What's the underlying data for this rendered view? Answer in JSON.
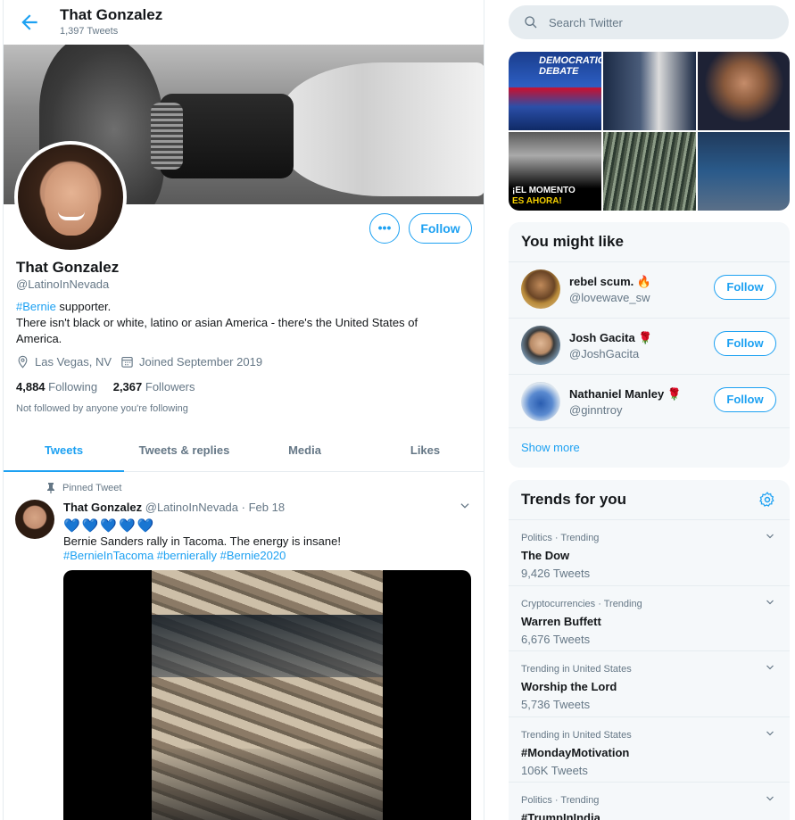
{
  "header": {
    "name": "That Gonzalez",
    "tweet_count": "1,397 Tweets"
  },
  "profile": {
    "name": "That Gonzalez",
    "handle": "@LatinoInNevada",
    "bio_hashtag": "#Bernie",
    "bio_hashtag_suffix": " supporter.",
    "bio_line2": "There isn't black or white, latino or asian America - there's the United States of America.",
    "location": "Las Vegas, NV",
    "joined": "Joined September 2019",
    "following_count": "4,884",
    "following_label": "Following",
    "followers_count": "2,367",
    "followers_label": "Followers",
    "not_followed": "Not followed by anyone you're following",
    "more_label": "•••",
    "follow_label": "Follow"
  },
  "tabs": [
    "Tweets",
    "Tweets & replies",
    "Media",
    "Likes"
  ],
  "tweet": {
    "pinned_label": "Pinned Tweet",
    "author_name": "That Gonzalez",
    "author_handle": "@LatinoInNevada",
    "date": "· Feb 18",
    "hearts": "💙💙💙💙💙",
    "text": "Bernie Sanders rally in Tacoma. The energy is insane!",
    "hashtags": "#BernieInTacoma #bernierally #Bernie2020"
  },
  "search": {
    "placeholder": "Search Twitter"
  },
  "photo_grid": {
    "debate_caption": "DEMOCRATIC DEBATE",
    "banner_text_line1": "¡EL MOMENTO",
    "banner_text_line2": "ES AHORA!"
  },
  "you_might_like": {
    "title": "You might like",
    "users": [
      {
        "name": "rebel scum. 🔥",
        "handle": "@lovewave_sw",
        "follow_label": "Follow"
      },
      {
        "name": "Josh Gacita 🌹",
        "handle": "@JoshGacita",
        "follow_label": "Follow"
      },
      {
        "name": "Nathaniel Manley 🌹",
        "handle": "@ginntroy",
        "follow_label": "Follow"
      }
    ],
    "show_more": "Show more"
  },
  "trends": {
    "title": "Trends for you",
    "items": [
      {
        "context": "Politics · Trending",
        "name": "The Dow",
        "count": "9,426 Tweets"
      },
      {
        "context": "Cryptocurrencies · Trending",
        "name": "Warren Buffett",
        "count": "6,676 Tweets"
      },
      {
        "context": "Trending in United States",
        "name": "Worship the Lord",
        "count": "5,736 Tweets"
      },
      {
        "context": "Trending in United States",
        "name": "#MondayMotivation",
        "count": "106K Tweets"
      },
      {
        "context": "Politics · Trending",
        "name": "#TrumpInIndia",
        "count": ""
      }
    ]
  },
  "colors": {
    "accent": "#1da1f2",
    "muted": "#657786",
    "panel_bg": "#f5f8fa",
    "text": "#14171a"
  }
}
